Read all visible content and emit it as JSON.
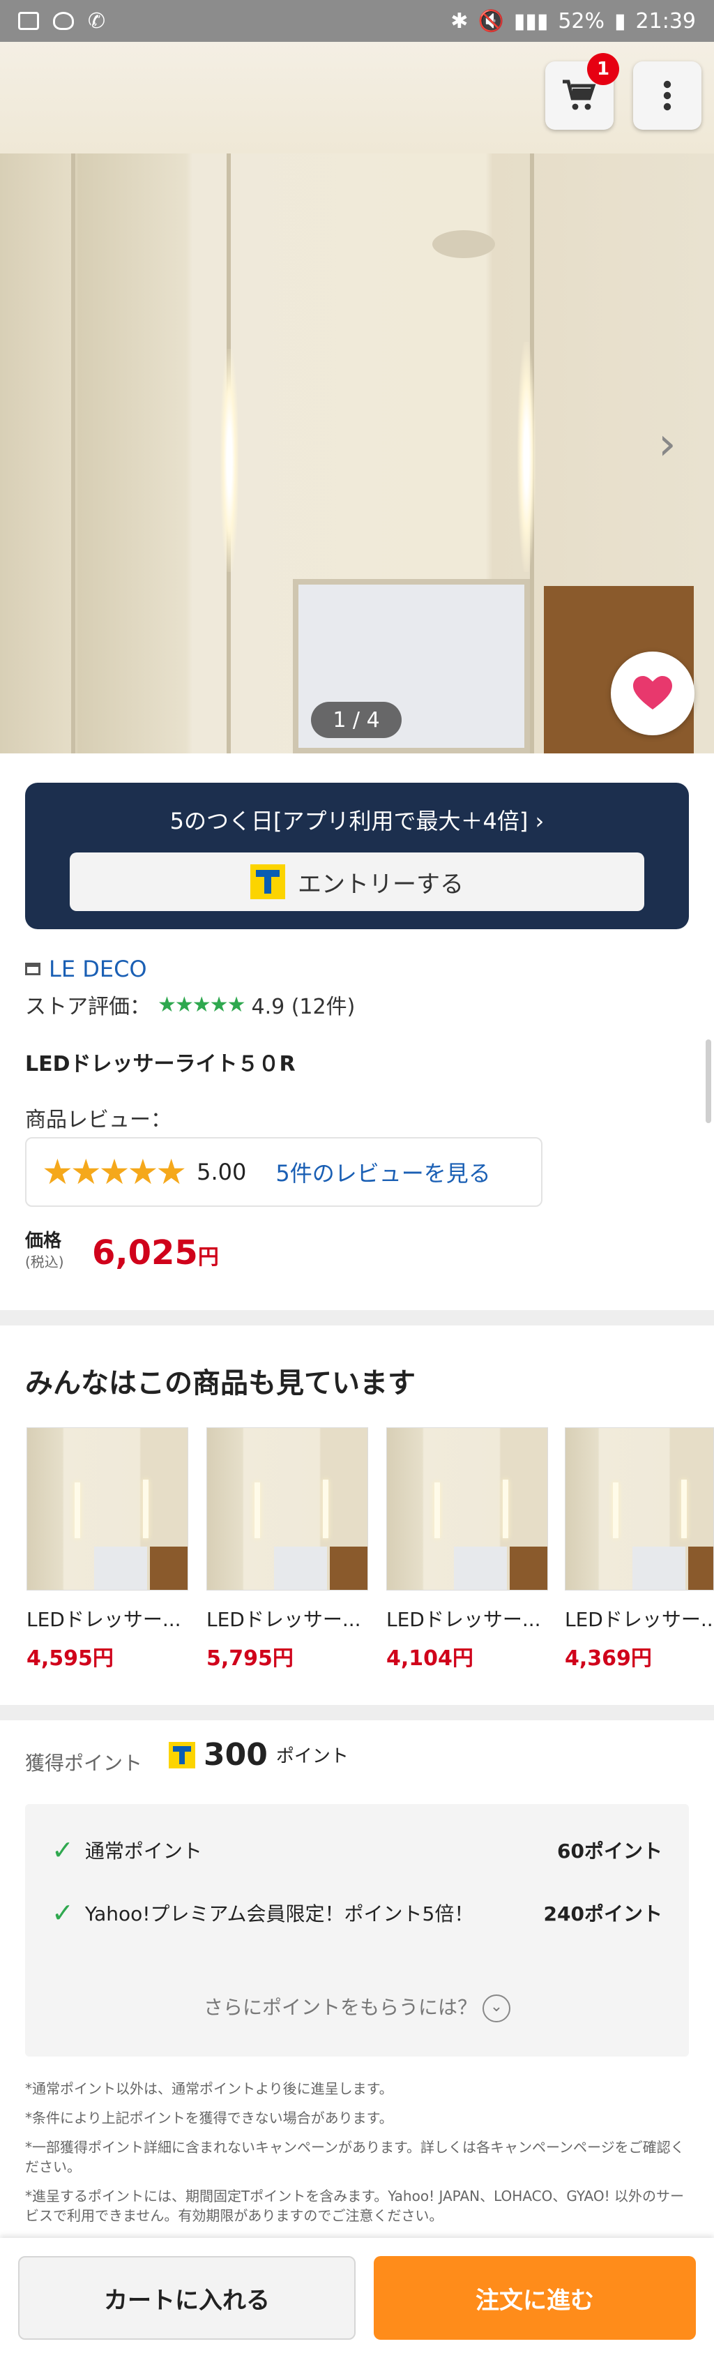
{
  "status_bar": {
    "battery": "52%",
    "time": "21:39"
  },
  "header": {
    "cart_count": "1",
    "image_counter": "1 / 4"
  },
  "promo": {
    "text": "5のつく日[アプリ利用で最大＋4倍]",
    "entry_label": "エントリーする"
  },
  "store": {
    "name": "LE DECO",
    "rating_label": "ストア評価：",
    "rating_value": "4.9 (12件)"
  },
  "product": {
    "name": "LEDドレッサーライト５０R",
    "review_label": "商品レビュー：",
    "review_score": "5.00",
    "review_link": "5件のレビューを見る",
    "price_label": "価格",
    "price_tax": "(税込)",
    "price": "6,025",
    "price_unit": "円"
  },
  "recommend": {
    "title": "みんなはこの商品も見ています",
    "items": [
      {
        "name": "LEDドレッサー...",
        "price": "4,595円"
      },
      {
        "name": "LEDドレッサー...",
        "price": "5,795円"
      },
      {
        "name": "LEDドレッサー...",
        "price": "4,104円"
      },
      {
        "name": "LEDドレッサー...",
        "price": "4,369円"
      }
    ]
  },
  "points": {
    "label": "獲得ポイント",
    "total": "300",
    "unit": "ポイント",
    "rows": [
      {
        "label": "通常ポイント",
        "value": "60ポイント"
      },
      {
        "label": "Yahoo!プレミアム会員限定！ポイント5倍！",
        "value": "240ポイント"
      }
    ],
    "more": "さらにポイントをもらうには？",
    "notes": [
      "*通常ポイント以外は、通常ポイントより後に進呈します。",
      "*条件により上記ポイントを獲得できない場合があります。",
      "*一部獲得ポイント詳細に含まれないキャンペーンがあります。詳しくは各キャンペーンページをご確認ください。",
      "*進呈するポイントには、期間固定Tポイントを含みます。Yahoo! JAPAN、LOHACO、GYAO! 以外のサービスで利用できません。有効期限がありますのでご注意ください。"
    ]
  },
  "bottom": {
    "add_cart": "カートに入れる",
    "order": "注文に進む"
  },
  "colors": {
    "price_red": "#d0021b",
    "promo_navy": "#1c2f4e",
    "order_orange": "#ff8c1a",
    "link_blue": "#1a5fb4"
  }
}
